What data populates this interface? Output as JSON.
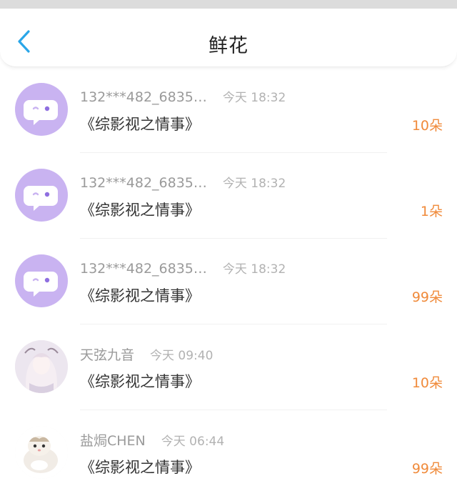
{
  "header": {
    "title": "鲜花",
    "back_icon": "chevron-left-icon",
    "accent": "#2aa6e8"
  },
  "records": [
    {
      "user": "132***482_6835…",
      "time": "今天 18:32",
      "book": "《综影视之情事》",
      "count": "10朵",
      "avatar": "bot"
    },
    {
      "user": "132***482_6835…",
      "time": "今天 18:32",
      "book": "《综影视之情事》",
      "count": "1朵",
      "avatar": "bot"
    },
    {
      "user": "132***482_6835…",
      "time": "今天 18:32",
      "book": "《综影视之情事》",
      "count": "99朵",
      "avatar": "bot"
    },
    {
      "user": "天弦九音",
      "time": "今天 09:40",
      "book": "《综影视之情事》",
      "count": "10朵",
      "avatar": "anime-girl"
    },
    {
      "user": "盐焗CHEN",
      "time": "今天 06:44",
      "book": "《综影视之情事》",
      "count": "99朵",
      "avatar": "hamster"
    }
  ],
  "colors": {
    "count": "#f08a3a",
    "bot_avatar": "#c9b3f1",
    "title": "#222222"
  }
}
